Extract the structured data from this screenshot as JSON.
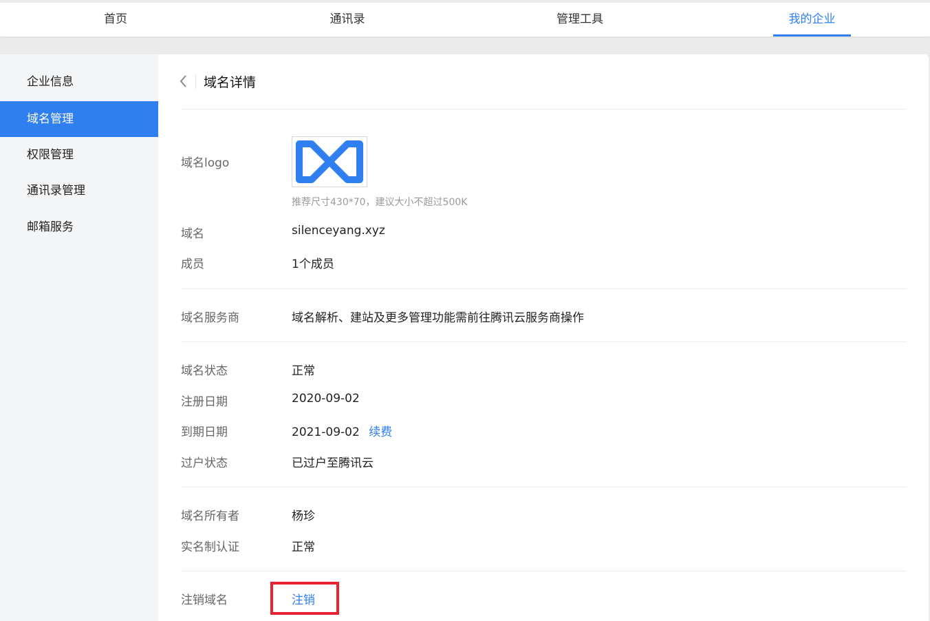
{
  "topnav": {
    "items": [
      "首页",
      "通讯录",
      "管理工具",
      "我的企业"
    ],
    "active_index": 3,
    "accent_color": "#2f7ff0"
  },
  "sidebar": {
    "items": [
      "企业信息",
      "域名管理",
      "权限管理",
      "通讯录管理",
      "邮箱服务"
    ],
    "active_index": 1
  },
  "detail": {
    "back_icon": "chevron-left-icon",
    "title": "域名详情",
    "logo_label": "域名logo",
    "logo_icon": "domain-logo-icon",
    "logo_hint": "推荐尺寸430*70，建议大小不超过500K",
    "domain_label": "域名",
    "domain_value": "silenceyang.xyz",
    "members_label": "成员",
    "members_value": "1个成员",
    "provider_label": "域名服务商",
    "provider_value": "域名解析、建站及更多管理功能需前往腾讯云服务商操作",
    "status_label": "域名状态",
    "status_value": "正常",
    "reg_date_label": "注册日期",
    "reg_date_value": "2020-09-02",
    "exp_date_label": "到期日期",
    "exp_date_value": "2021-09-02",
    "renew_link": "续费",
    "transfer_label": "过户状态",
    "transfer_value": "已过户至腾讯云",
    "owner_label": "域名所有者",
    "owner_value": "杨珍",
    "realname_label": "实名制认证",
    "realname_value": "正常",
    "cancel_label": "注销域名",
    "cancel_link": "注销"
  },
  "colors": {
    "accent": "#2f7ff0",
    "highlight": "#e8232f"
  }
}
